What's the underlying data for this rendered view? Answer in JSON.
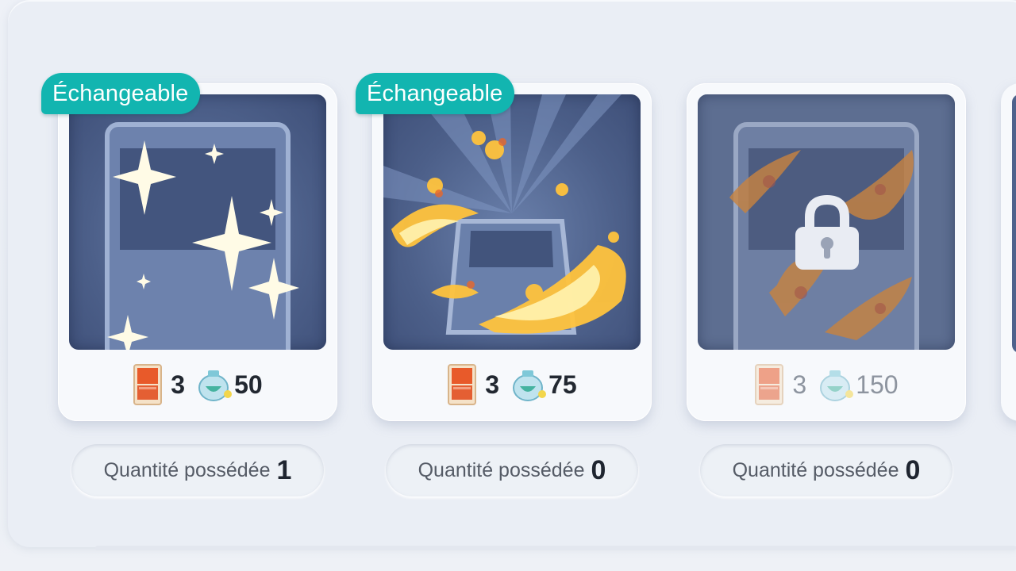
{
  "items": [
    {
      "badge": "Échangeable",
      "effect": "sparkle",
      "locked": false,
      "pack_cost": "3",
      "hourglass_cost": "50",
      "owned_label": "Quantité possédée",
      "owned_count": "1"
    },
    {
      "badge": "Échangeable",
      "effect": "fire",
      "locked": false,
      "pack_cost": "3",
      "hourglass_cost": "75",
      "owned_label": "Quantité possédée",
      "owned_count": "0"
    },
    {
      "badge": "",
      "effect": "fire-locked",
      "locked": true,
      "pack_cost": "3",
      "hourglass_cost": "150",
      "owned_label": "Quantité possédée",
      "owned_count": "0"
    }
  ],
  "icons": {
    "pack": "card-pack-icon",
    "hourglass": "pack-hourglass-icon",
    "lock": "lock-icon"
  },
  "colors": {
    "badge": "#12b5b0",
    "art_background": "#4c5f89",
    "text_dark": "#222831",
    "text_muted": "#8d949f"
  }
}
